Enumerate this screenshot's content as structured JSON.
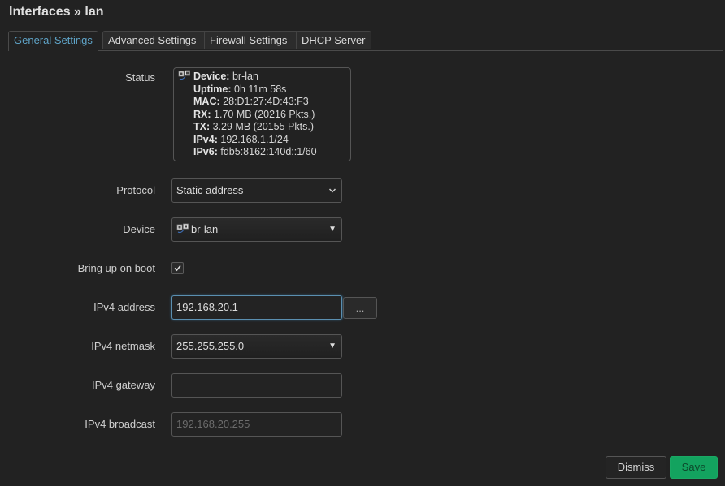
{
  "page": {
    "title": "Interfaces » lan"
  },
  "tabs": [
    {
      "label": "General Settings",
      "active": true
    },
    {
      "label": "Advanced Settings",
      "active": false
    },
    {
      "label": "Firewall Settings",
      "active": false
    },
    {
      "label": "DHCP Server",
      "active": false
    }
  ],
  "status": {
    "label": "Status",
    "icon": "network-device-icon",
    "lines": [
      {
        "key": "Device:",
        "value": "br-lan"
      },
      {
        "key": "Uptime:",
        "value": "0h 11m 58s"
      },
      {
        "key": "MAC:",
        "value": "28:D1:27:4D:43:F3"
      },
      {
        "key": "RX:",
        "value": "1.70 MB (20216 Pkts.)"
      },
      {
        "key": "TX:",
        "value": "3.29 MB (20155 Pkts.)"
      },
      {
        "key": "IPv4:",
        "value": "192.168.1.1/24"
      },
      {
        "key": "IPv6:",
        "value": "fdb5:8162:140d::1/60"
      }
    ]
  },
  "form": {
    "protocol": {
      "label": "Protocol",
      "value": "Static address",
      "icon": "chevron-down-icon"
    },
    "device": {
      "label": "Device",
      "value": "br-lan",
      "icon": "network-device-icon"
    },
    "bring_up_on_boot": {
      "label": "Bring up on boot",
      "checked": true
    },
    "ipv4_address": {
      "label": "IPv4 address",
      "value": "192.168.20.1",
      "more_label": "..."
    },
    "ipv4_netmask": {
      "label": "IPv4 netmask",
      "value": "255.255.255.0"
    },
    "ipv4_gateway": {
      "label": "IPv4 gateway",
      "value": ""
    },
    "ipv4_broadcast": {
      "label": "IPv4 broadcast",
      "value": "",
      "placeholder": "192.168.20.255"
    }
  },
  "actions": {
    "dismiss_label": "Dismiss",
    "save_label": "Save"
  },
  "colors": {
    "background": "#222222",
    "accent_tab": "#5fa4c8",
    "save_green": "#13a35f",
    "focus_border": "#5b8fb0"
  }
}
